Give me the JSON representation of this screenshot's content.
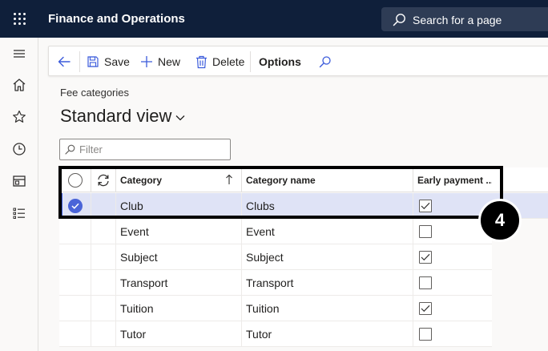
{
  "app": {
    "title": "Finance and Operations"
  },
  "search": {
    "label": "Search for a page"
  },
  "toolbar": {
    "save_label": "Save",
    "new_label": "New",
    "delete_label": "Delete",
    "options_label": "Options"
  },
  "page": {
    "breadcrumb": "Fee categories",
    "view_title": "Standard view"
  },
  "filter": {
    "placeholder": "Filter"
  },
  "grid": {
    "columns": {
      "category": "Category",
      "category_name": "Category name",
      "early_payment": "Early payment ..."
    },
    "rows": [
      {
        "category": "Club",
        "category_name": "Clubs",
        "early_payment": true,
        "selected": true
      },
      {
        "category": "Event",
        "category_name": "Event",
        "early_payment": false,
        "selected": false
      },
      {
        "category": "Subject",
        "category_name": "Subject",
        "early_payment": true,
        "selected": false
      },
      {
        "category": "Transport",
        "category_name": "Transport",
        "early_payment": false,
        "selected": false
      },
      {
        "category": "Tuition",
        "category_name": "Tuition",
        "early_payment": true,
        "selected": false
      },
      {
        "category": "Tutor",
        "category_name": "Tutor",
        "early_payment": false,
        "selected": false
      }
    ]
  },
  "callout": {
    "number": "4"
  },
  "colors": {
    "topbar": "#0f1f3a",
    "accent": "#3b5bdb",
    "selected_row": "#dfe3f6"
  },
  "icons": {
    "waffle": "waffle-icon",
    "search": "search-icon",
    "nav": [
      "hamburger-icon",
      "home-icon",
      "star-icon",
      "clock-icon",
      "workspace-icon",
      "list-icon"
    ],
    "toolbar": [
      "back-arrow-icon",
      "save-icon",
      "plus-icon",
      "delete-icon",
      "search-icon"
    ]
  }
}
